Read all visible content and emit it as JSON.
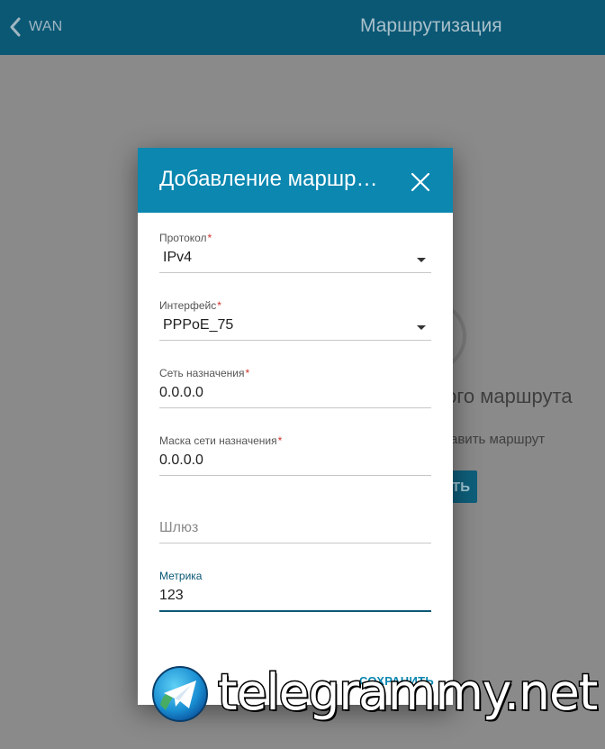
{
  "header": {
    "back_label": "WAN",
    "page_title": "Маршрутизация"
  },
  "background": {
    "empty_title": "ного маршрута",
    "hint": "авить маршрут",
    "button_label": "ТЬ"
  },
  "dialog": {
    "title": "Добавление маршр…",
    "fields": {
      "protocol": {
        "label": "Протокол",
        "required": "*",
        "value": "IPv4"
      },
      "interface": {
        "label": "Интерфейс",
        "required": "*",
        "value": "PPPoE_75"
      },
      "dest_network": {
        "label": "Сеть назначения",
        "required": "*",
        "value": "0.0.0.0"
      },
      "dest_mask": {
        "label": "Маска сети назначения",
        "required": "*",
        "value": "0.0.0.0"
      },
      "gateway": {
        "placeholder": "Шлюз",
        "value": ""
      },
      "metric": {
        "label": "Метрика",
        "value": "123"
      }
    },
    "save_label": "СОХРАНИТЬ"
  },
  "watermark": {
    "text": "telegrammy.net",
    "logo_icon": "telegram-logo"
  },
  "colors": {
    "topbar": "#0b5875",
    "dialog_header": "#0b87b0",
    "accent": "#0b5875",
    "required": "#d0302b"
  }
}
